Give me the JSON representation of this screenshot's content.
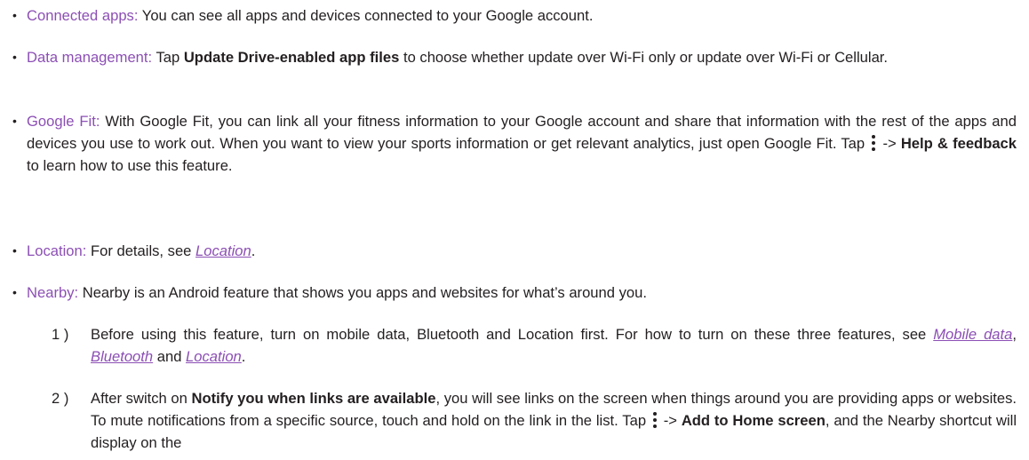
{
  "bullets": {
    "connected_apps": {
      "term": "Connected apps:",
      "text": " You can see all apps and devices connected to your Google account."
    },
    "data_management": {
      "term": "Data management:",
      "pre": " Tap ",
      "bold": "Update Drive-enabled app files",
      "post": " to choose whether update over Wi-Fi only or update over Wi-Fi or Cellular."
    },
    "google_fit": {
      "term": "Google Fit:",
      "pre": " With Google Fit, you can link all your fitness information to your Google account and share that information with the rest of the apps and devices you use to work out. When you want to view your sports information or get relevant analytics, just open Google Fit. Tap ",
      "arrow": " -> ",
      "bold": "Help & feedback",
      "post": " to learn how to use this feature."
    },
    "location": {
      "term": "Location:",
      "pre": " For details, see ",
      "link": "Location",
      "post": "."
    },
    "nearby": {
      "term": "Nearby:",
      "text": " Nearby is an Android feature that shows you apps and websites for what’s around you."
    }
  },
  "steps": {
    "step1": {
      "num": "1 )",
      "pre": "Before using this feature, turn on mobile data, Bluetooth and Location first. For how to turn on these three features, see ",
      "link1": "Mobile data",
      "sep1": ", ",
      "link2": "Bluetooth",
      "sep2": " and ",
      "link3": "Location",
      "post": "."
    },
    "step2": {
      "num": "2 )",
      "pre": "After switch on ",
      "bold1": "Notify you when links are available",
      "mid": ", you will see links on the screen when things around you are providing apps or websites. To mute notifications from a specific source, touch and hold on the link in the list. Tap ",
      "arrow": " -> ",
      "bold2": "Add to Home screen",
      "post": ", and the Nearby shortcut will display on the"
    }
  },
  "bullet_glyph": "•",
  "colors": {
    "accent": "#8c4fb5",
    "text": "#231f20"
  },
  "icons": {
    "menu": "more-vert-icon"
  }
}
